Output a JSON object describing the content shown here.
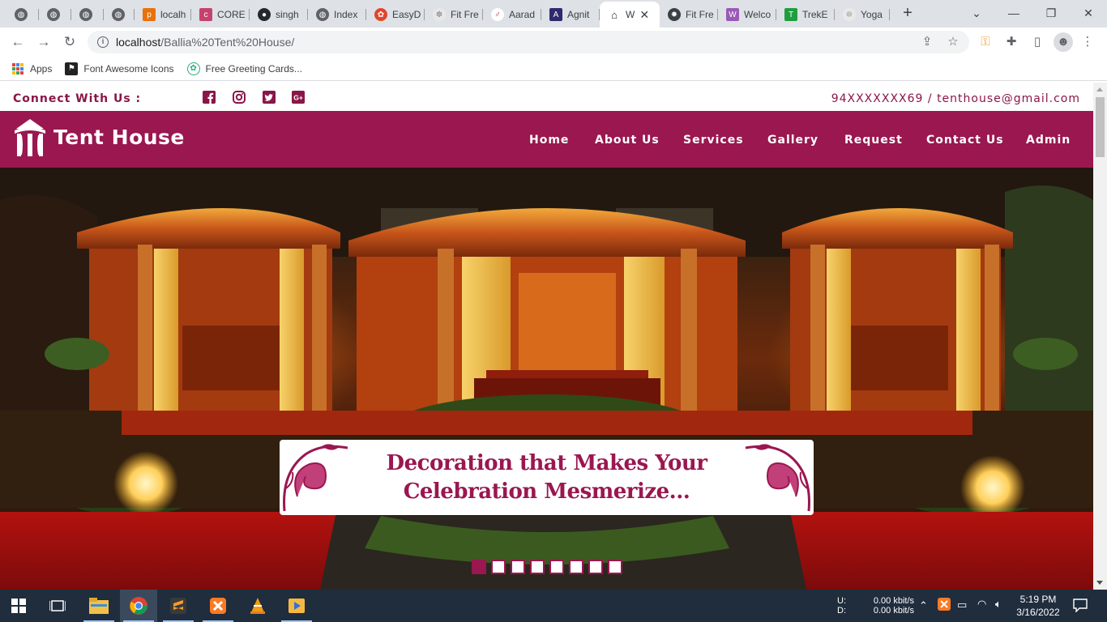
{
  "browser": {
    "tabs": [
      {
        "label": "",
        "favicon": "globe"
      },
      {
        "label": "",
        "favicon": "globe"
      },
      {
        "label": "",
        "favicon": "globe"
      },
      {
        "label": "",
        "favicon": "globe"
      },
      {
        "label": "localh",
        "favicon": "phpmyadmin"
      },
      {
        "label": "CORE",
        "favicon": "core"
      },
      {
        "label": "singh",
        "favicon": "github"
      },
      {
        "label": "Index",
        "favicon": "globe"
      },
      {
        "label": "EasyD",
        "favicon": "easyd"
      },
      {
        "label": "Fit Fre",
        "favicon": "fit"
      },
      {
        "label": "Aarad",
        "favicon": "aarad"
      },
      {
        "label": "Agnit",
        "favicon": "agnit"
      },
      {
        "label": "W",
        "favicon": "tent",
        "active": true
      },
      {
        "label": "Fit Fre",
        "favicon": "fit2"
      },
      {
        "label": "Welco",
        "favicon": "welco"
      },
      {
        "label": "TrekE",
        "favicon": "trek"
      },
      {
        "label": "Yoga",
        "favicon": "yoga"
      }
    ],
    "new_tab": "+",
    "url_host": "localhost",
    "url_path": "/Ballia%20Tent%20House/",
    "bookmarks": [
      {
        "label": "Apps",
        "icon": "apps-grid-icon"
      },
      {
        "label": "Font Awesome Icons",
        "icon": "flag-icon"
      },
      {
        "label": "Free Greeting Cards...",
        "icon": "card-icon"
      }
    ]
  },
  "site": {
    "connect_label": "Connect With Us :",
    "contact_info": "94XXXXXXX69 / tenthouse@gmail.com",
    "social_icons": [
      "facebook-icon",
      "instagram-icon",
      "twitter-icon",
      "google-plus-icon"
    ],
    "brand": "Tent House",
    "nav": [
      "Home",
      "About Us",
      "Services",
      "Gallery",
      "Request",
      "Contact Us",
      "Admin"
    ],
    "hero": {
      "caption_line1": "Decoration that Makes Your",
      "caption_line2": "Celebration Mesmerize...",
      "slide_count": 8,
      "active_slide": 1
    },
    "colors": {
      "brand": "#9a1750",
      "text_accent": "#8a1648"
    }
  },
  "taskbar": {
    "net_label_up": "U:",
    "net_label_down": "D:",
    "net_up": "0.00 kbit/s",
    "net_down": "0.00 kbit/s",
    "time": "5:19 PM",
    "date": "3/16/2022"
  }
}
